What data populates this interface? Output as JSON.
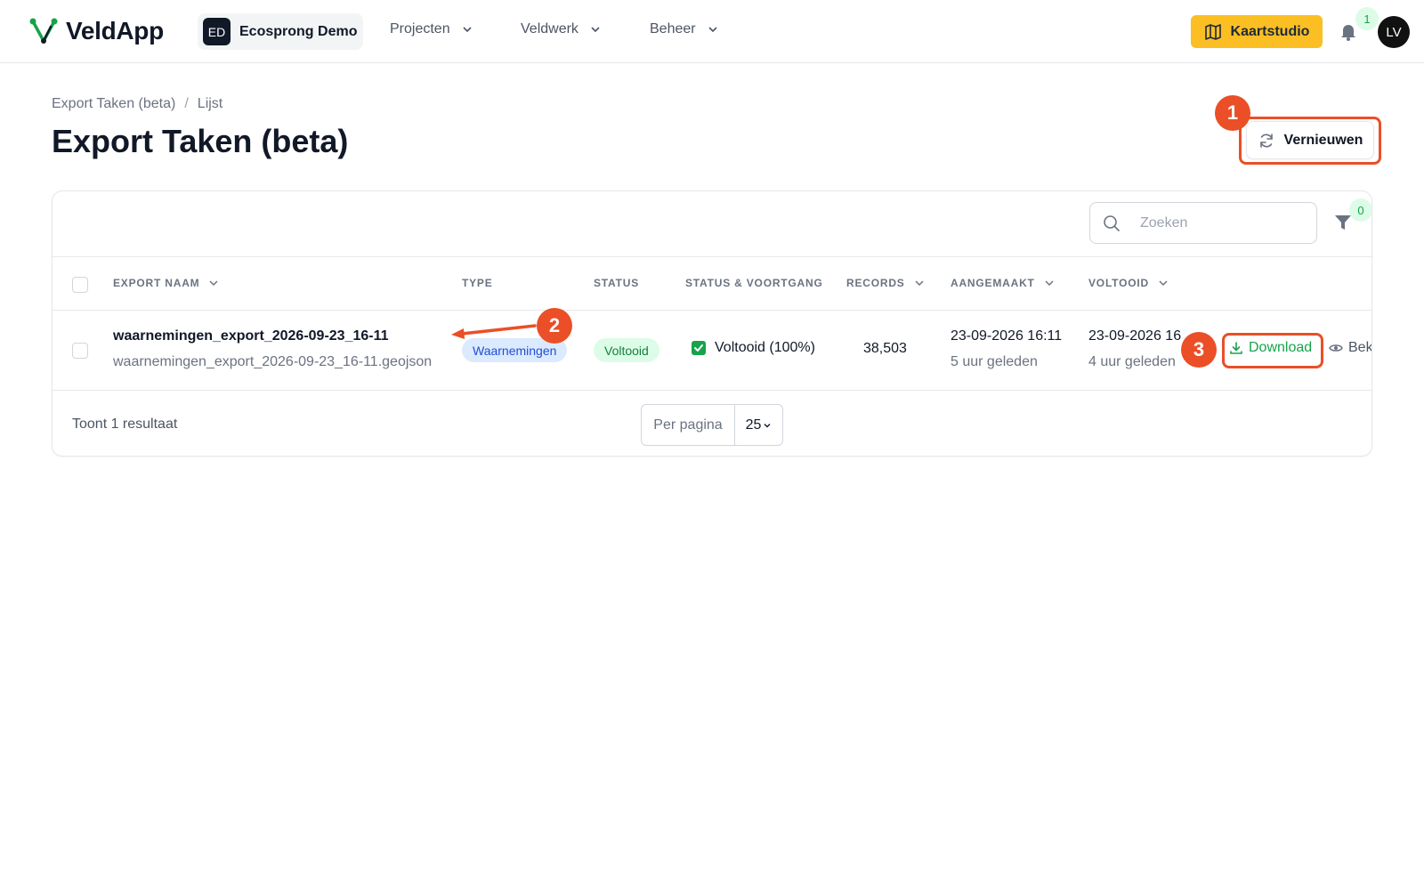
{
  "app": {
    "name": "VeldApp"
  },
  "org": {
    "initials": "ED",
    "name": "Ecosprong Demo"
  },
  "nav": {
    "items": [
      {
        "label": "Projecten"
      },
      {
        "label": "Veldwerk"
      },
      {
        "label": "Beheer"
      }
    ]
  },
  "kaartstudio": {
    "label": "Kaartstudio"
  },
  "notifications": {
    "count": "1"
  },
  "user": {
    "initials": "LV"
  },
  "breadcrumb": {
    "root": "Export Taken (beta)",
    "separator": "/",
    "current": "Lijst"
  },
  "page": {
    "title": "Export Taken (beta)"
  },
  "refresh": {
    "label": "Vernieuwen"
  },
  "markers": [
    "1",
    "2",
    "3"
  ],
  "search": {
    "placeholder": "Zoeken"
  },
  "filter": {
    "count": "0"
  },
  "table": {
    "columns": [
      "EXPORT NAAM",
      "TYPE",
      "STATUS",
      "STATUS & VOORTGANG",
      "RECORDS",
      "AANGEMAAKT",
      "VOLTOOID"
    ],
    "rows": [
      {
        "name": "waarnemingen_export_2026-09-23_16-11",
        "file": "waarnemingen_export_2026-09-23_16-11.geojson",
        "type": "Waarnemingen",
        "status": "Voltooid",
        "progress": "Voltooid (100%)",
        "records": "38,503",
        "created": "23-09-2026 16:11",
        "created_rel": "5 uur geleden",
        "completed": "23-09-2026 16",
        "completed_rel": "4 uur geleden",
        "download_label": "Download",
        "view_label": "Bek"
      }
    ]
  },
  "footer": {
    "results": "Toont 1 resultaat",
    "per_page_label": "Per pagina",
    "per_page_value": "25"
  },
  "colors": {
    "accent": "#ea4f27",
    "brand": "#16a34a",
    "kaart": "#fbbf24"
  }
}
